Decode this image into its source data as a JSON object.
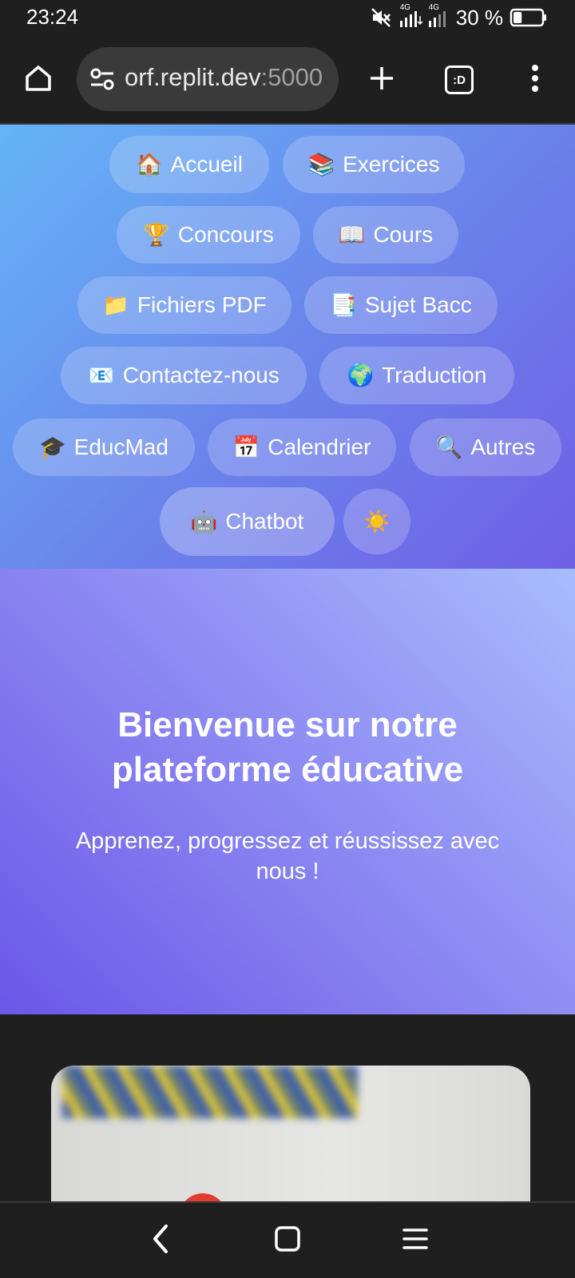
{
  "status_bar": {
    "time": "23:24",
    "network_label_1": "4G",
    "network_label_2": "4G",
    "battery_percent": "30 %",
    "battery_level": 0.3,
    "icons": [
      "mute-icon",
      "signal-icon",
      "battery-icon"
    ]
  },
  "browser": {
    "url_main": "orf.replit.dev",
    "url_port": ":5000",
    "tab_switcher_label": ":D",
    "icons": [
      "home-icon",
      "site-settings-icon",
      "plus-icon",
      "tabs-icon",
      "more-vert-icon"
    ]
  },
  "nav": {
    "items": [
      {
        "emoji": "🏠",
        "label": "Accueil"
      },
      {
        "emoji": "📚",
        "label": "Exercices"
      },
      {
        "emoji": "🏆",
        "label": "Concours"
      },
      {
        "emoji": "📖",
        "label": "Cours"
      },
      {
        "emoji": "📁",
        "label": "Fichiers PDF"
      },
      {
        "emoji": "📑",
        "label": "Sujet Bacc"
      },
      {
        "emoji": "📧",
        "label": "Contactez-nous"
      },
      {
        "emoji": "🌍",
        "label": "Traduction"
      },
      {
        "emoji": "🎓",
        "label": "EducMad"
      },
      {
        "emoji": "📅",
        "label": "Calendrier"
      },
      {
        "emoji": "🔍",
        "label": "Autres"
      },
      {
        "emoji": "🤖",
        "label": "Chatbot"
      }
    ],
    "theme_toggle_emoji": "☀️"
  },
  "hero": {
    "title_line1": "Bienvenue sur notre",
    "title_line2": "plateforme éducative",
    "subtitle": "Apprenez, progressez et réussissez avec nous !"
  },
  "system_nav": {
    "icons": [
      "back-icon",
      "home-square-icon",
      "recents-icon"
    ]
  },
  "colors": {
    "nav_gradient": [
      "#64b5f6",
      "#6f5fe6"
    ],
    "hero_gradient": [
      "#6b57e8",
      "#a8bcfd"
    ],
    "chrome_bg": "#1f1f1f"
  }
}
